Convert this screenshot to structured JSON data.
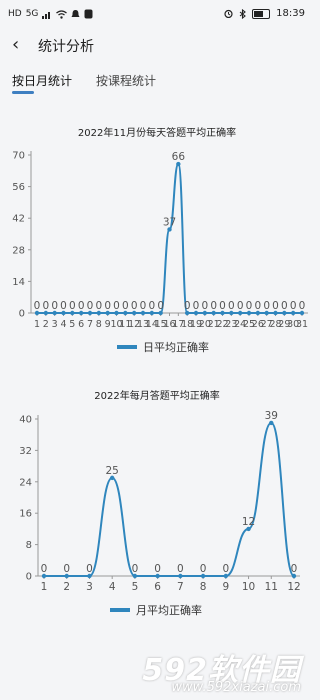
{
  "status_bar": {
    "left_icons": [
      "HD",
      "5G",
      "signal-icon",
      "wifi-icon",
      "notification-icon",
      "app-icon"
    ],
    "right_icons": [
      "alarm-icon",
      "bluetooth-icon",
      "battery-icon"
    ],
    "battery_level": 0.7,
    "time": "18:39"
  },
  "header": {
    "back_icon": "chevron-left-icon",
    "title": "统计分析"
  },
  "tabs": [
    {
      "label": "按日月统计",
      "active": true
    },
    {
      "label": "按课程统计",
      "active": false
    }
  ],
  "colors": {
    "accent": "#3e7fc1",
    "line": "#2f86bd",
    "axis": "#999999",
    "label": "#555555"
  },
  "chart_data": [
    {
      "type": "line",
      "title": "2022年11月份每天答题平均正确率",
      "categories": [
        "1",
        "2",
        "3",
        "4",
        "5",
        "6",
        "7",
        "8",
        "9",
        "10",
        "11",
        "12",
        "13",
        "14",
        "15",
        "16",
        "17",
        "18",
        "19",
        "20",
        "21",
        "22",
        "23",
        "24",
        "25",
        "26",
        "27",
        "28",
        "29",
        "30",
        "31"
      ],
      "series": [
        {
          "name": "日平均正确率",
          "values": [
            0,
            0,
            0,
            0,
            0,
            0,
            0,
            0,
            0,
            0,
            0,
            0,
            0,
            0,
            0,
            37,
            66,
            0,
            0,
            0,
            0,
            0,
            0,
            0,
            0,
            0,
            0,
            0,
            0,
            0,
            0
          ]
        }
      ],
      "yticks": [
        "0",
        "14",
        "28",
        "42",
        "56",
        "70"
      ],
      "ylim": [
        0,
        70
      ],
      "smooth": true,
      "legend": "bottom"
    },
    {
      "type": "line",
      "title": "2022年每月答题平均正确率",
      "categories": [
        "1",
        "2",
        "3",
        "4",
        "5",
        "6",
        "7",
        "8",
        "9",
        "10",
        "11",
        "12"
      ],
      "series": [
        {
          "name": "月平均正确率",
          "values": [
            0,
            0,
            0,
            25,
            0,
            0,
            0,
            0,
            0,
            12,
            39,
            0
          ]
        }
      ],
      "yticks": [
        "0",
        "8",
        "16",
        "24",
        "32",
        "40"
      ],
      "ylim": [
        0,
        40
      ],
      "smooth": true,
      "legend": "bottom"
    }
  ],
  "watermark": {
    "text": "592软件园",
    "url": "www.592xiazai.com"
  }
}
